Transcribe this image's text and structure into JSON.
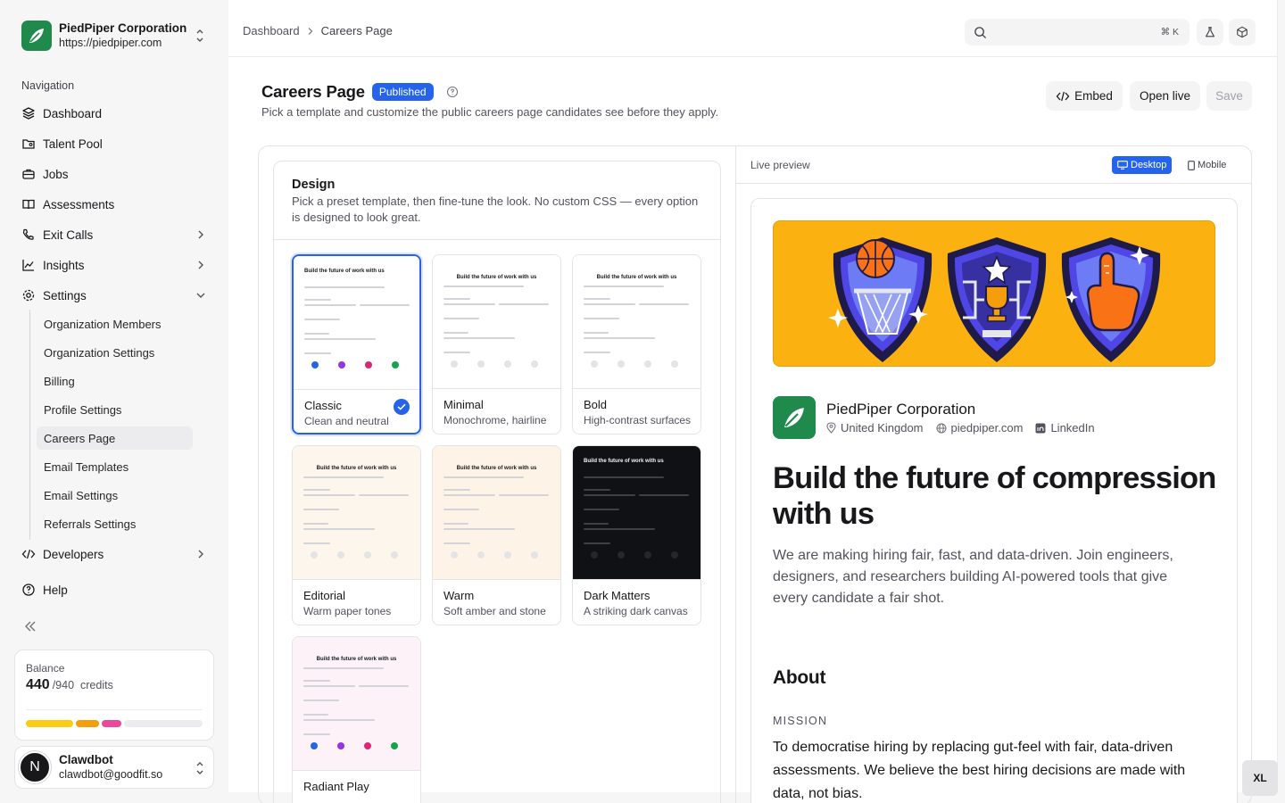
{
  "org": {
    "name": "PiedPiper Corporation",
    "url": "https://piedpiper.com"
  },
  "nav": {
    "label": "Navigation",
    "items": [
      {
        "label": "Dashboard",
        "icon": "layers-icon"
      },
      {
        "label": "Talent Pool",
        "icon": "folder-user-icon"
      },
      {
        "label": "Jobs",
        "icon": "briefcase-icon"
      },
      {
        "label": "Assessments",
        "icon": "book-icon"
      },
      {
        "label": "Exit Calls",
        "icon": "phone-icon"
      },
      {
        "label": "Insights",
        "icon": "chart-line-icon"
      },
      {
        "label": "Settings",
        "icon": "gear-icon"
      },
      {
        "label": "Developers",
        "icon": "code-icon"
      },
      {
        "label": "Help",
        "icon": "help-circle-icon"
      }
    ],
    "settings_sub": [
      "Organization Members",
      "Organization Settings",
      "Billing",
      "Profile Settings",
      "Careers Page",
      "Email Templates",
      "Email Settings",
      "Referrals Settings"
    ]
  },
  "balance": {
    "label": "Balance",
    "value": "440",
    "total": "/940",
    "unit": "credits",
    "segments_pct": [
      27,
      13,
      11
    ],
    "colors": [
      "#facc15",
      "#f59e0b",
      "#ec4899"
    ]
  },
  "user": {
    "initial": "N",
    "name": "Clawdbot",
    "email": "clawdbot@goodfit.so"
  },
  "breadcrumb": [
    "Dashboard",
    "Careers Page"
  ],
  "search": {
    "placeholder": "",
    "shortcut": "⌘ K"
  },
  "page": {
    "title": "Careers Page",
    "status": "Published",
    "subtitle": "Pick a template and customize the public careers page candidates see before they apply.",
    "actions": {
      "embed": "Embed",
      "open_live": "Open live",
      "save": "Save"
    }
  },
  "design": {
    "title": "Design",
    "description": "Pick a preset template, then fine-tune the look. No custom CSS — every option is designed to look great.",
    "mini_heading": "Build the future of work with us",
    "templates": [
      {
        "name": "Classic",
        "desc": "Clean and neutral",
        "bg": "#ffffff",
        "selected": true
      },
      {
        "name": "Minimal",
        "desc": "Monochrome, hairline",
        "bg": "#ffffff",
        "selected": false
      },
      {
        "name": "Bold",
        "desc": "High-contrast surfaces",
        "bg": "#ffffff",
        "selected": false
      },
      {
        "name": "Editorial",
        "desc": "Warm paper tones",
        "bg": "#fdf6ec",
        "selected": false
      },
      {
        "name": "Warm",
        "desc": "Soft amber and stone",
        "bg": "#fdf3e6",
        "selected": false
      },
      {
        "name": "Dark Matters",
        "desc": "A striking dark canvas",
        "bg": "#0f1115",
        "selected": false
      },
      {
        "name": "Radiant Play",
        "desc": "",
        "bg": "#fdf2f8",
        "selected": false
      }
    ]
  },
  "preview": {
    "label": "Live preview",
    "modes": {
      "desktop": "Desktop",
      "mobile": "Mobile"
    },
    "active_mode": "Desktop",
    "company": "PiedPiper Corporation",
    "location": "United Kingdom",
    "website": "piedpiper.com",
    "social": "LinkedIn",
    "headline": "Build the future of compression with us",
    "intro": "We are making hiring fair, fast, and data-driven. Join engineers, designers, and researchers building AI-powered tools that give every candidate a fair shot.",
    "about_heading": "About",
    "mission_label": "MISSION",
    "mission_text": "To democratise hiring by replacing gut-feel with fair, data-driven assessments. We believe the best hiring decisions are made with data, not bias."
  },
  "corner_badge": "XL"
}
